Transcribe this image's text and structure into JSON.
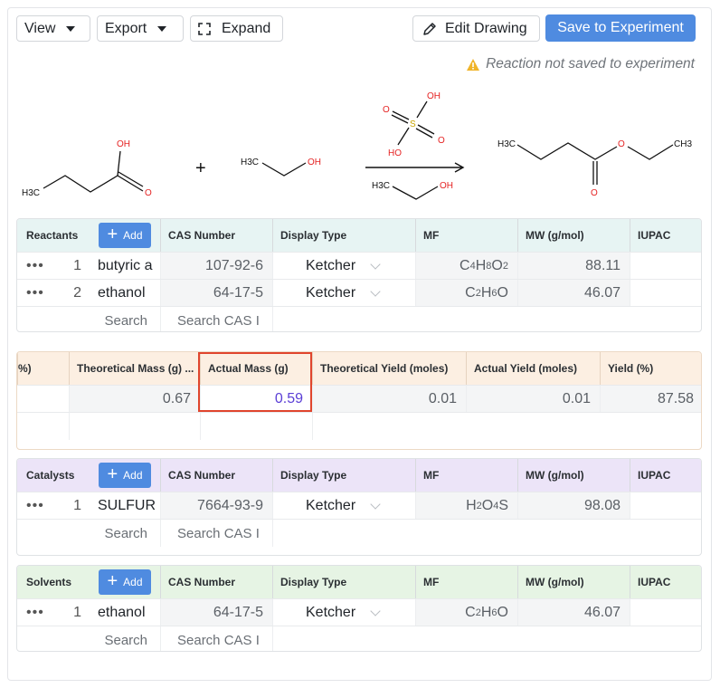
{
  "toolbar": {
    "view_label": "View",
    "export_label": "Export",
    "expand_label": "Expand",
    "edit_drawing_label": "Edit Drawing",
    "save_label": "Save to Experiment",
    "warning_text": "Reaction not saved to experiment"
  },
  "reaction": {
    "reactant1": {
      "oh": "OH",
      "o": "O",
      "ch3": "H3C"
    },
    "plus": "+",
    "reactant2": {
      "ch3": "H3C",
      "oh": "OH"
    },
    "catalyst": {
      "oh": "OH",
      "o1": "O",
      "s": "S",
      "o2": "O",
      "ho": "HO"
    },
    "solvent": {
      "ch3": "H3C",
      "oh": "OH"
    },
    "product": {
      "ch3a": "H3C",
      "o": "O",
      "ch3b": "CH3",
      "co": "O"
    }
  },
  "reactants": {
    "title": "Reactants",
    "add_label": "Add",
    "columns": [
      "CAS Number",
      "Display Type",
      "MF",
      "MW (g/mol)",
      "IUPAC"
    ],
    "rows": [
      {
        "idx": "1",
        "name": "butyric a",
        "cas": "107-92-6",
        "display": "Ketcher",
        "mf": [
          "C",
          "4",
          "H",
          "8",
          "O",
          "2"
        ],
        "mw": "88.11"
      },
      {
        "idx": "2",
        "name": "ethanol",
        "cas": "64-17-5",
        "display": "Ketcher",
        "mf": [
          "C",
          "2",
          "H",
          "6",
          "O",
          ""
        ],
        "mw": "46.07"
      }
    ],
    "search_name_placeholder": "Search",
    "search_cas_placeholder": "Search CAS I"
  },
  "yield": {
    "columns": [
      "%)",
      "Theoretical Mass (g) ...",
      "Actual Mass (g)",
      "Theoretical Yield (moles)",
      "Actual Yield (moles)",
      "Yield (%)"
    ],
    "row": {
      "theoretical_mass": "0.67",
      "actual_mass": "0.59",
      "theoretical_yield": "0.01",
      "actual_yield": "0.01",
      "yield_pct": "87.58"
    }
  },
  "catalysts": {
    "title": "Catalysts",
    "add_label": "Add",
    "columns": [
      "CAS Number",
      "Display Type",
      "MF",
      "MW (g/mol)",
      "IUPAC"
    ],
    "rows": [
      {
        "idx": "1",
        "name": "SULFUR",
        "cas": "7664-93-9",
        "display": "Ketcher",
        "mf": [
          "H",
          "2",
          "O",
          "4",
          "S",
          ""
        ],
        "mw": "98.08"
      }
    ],
    "search_name_placeholder": "Search",
    "search_cas_placeholder": "Search CAS I"
  },
  "solvents": {
    "title": "Solvents",
    "add_label": "Add",
    "columns": [
      "CAS Number",
      "Display Type",
      "MF",
      "MW (g/mol)",
      "IUPAC"
    ],
    "rows": [
      {
        "idx": "1",
        "name": "ethanol",
        "cas": "64-17-5",
        "display": "Ketcher",
        "mf": [
          "C",
          "2",
          "H",
          "6",
          "O",
          ""
        ],
        "mw": "46.07"
      }
    ],
    "search_name_placeholder": "Search",
    "search_cas_placeholder": "Search CAS I"
  },
  "colors": {
    "accent": "#4f8be0",
    "reactants_header": "#e7f4f3",
    "yield_header": "#fcefe2",
    "catalysts_header": "#ece4f8",
    "solvents_header": "#e6f4e4",
    "highlight_border": "#e0452d",
    "actual_mass_text": "#5b3fd6",
    "warning_icon": "#f0b429",
    "atom_red": "#e52222"
  },
  "icons": {
    "view_caret": "caret-down-icon",
    "export_caret": "caret-down-icon",
    "expand": "expand-icon",
    "edit": "pencil-icon",
    "warning": "warning-icon",
    "add": "plus-icon",
    "row_menu": "ellipsis-icon",
    "display_dropdown": "chevron-down-icon"
  }
}
